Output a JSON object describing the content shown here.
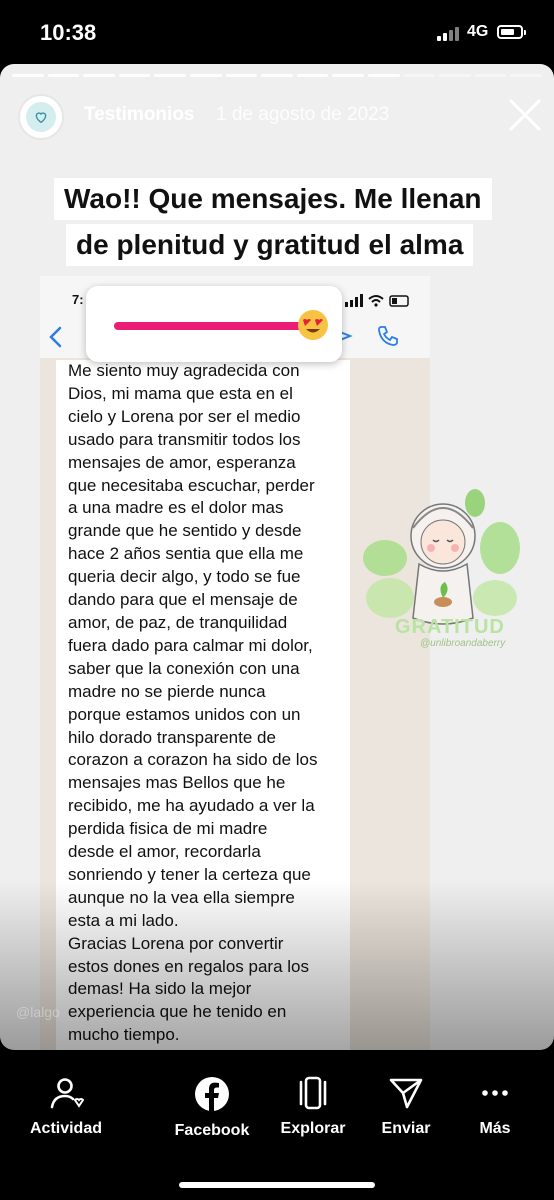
{
  "status_bar": {
    "time": "10:38",
    "network": "4G"
  },
  "story": {
    "account_name": "Testimonios",
    "date": "1 de agosto de 2023",
    "headline_line1": "Wao!! Que mensajes. Me llenan",
    "headline_line2": "de plenitud y gratitud el alma",
    "screenshot": {
      "phone_time": "7:",
      "message": "Me siento muy agradecida con\nDios, mi mama que esta en el\ncielo y Lorena por ser el medio\nusado para transmitir todos los\nmensajes de amor, esperanza\nque necesitaba escuchar, perder\na una madre es el dolor mas\ngrande que he sentido y desde\nhace 2 años sentia que ella me\nqueria decir algo, y todo se fue\ndando para que el mensaje de\namor, de paz, de tranquilidad\nfuera dado para calmar mi dolor,\nsaber que la conexión con una\nmadre no se pierde nunca\nporque estamos unidos con un\nhilo dorado transparente de\ncorazon a corazon ha sido de los\nmensajes mas Bellos que he\nrecibido, me ha ayudado a ver la\nperdida fisica de mi madre\ndesde el amor, recordarla\nsonriendo y tener la certeza que\naunque no la vea ella siempre\nesta a mi lado.\nGracias Lorena por convertir\nestos dones en regalos para los\ndemas! Ha sido la mejor\nexperiencia que he tenido en\nmucho tiempo."
    },
    "slider": {
      "emoji": "heart-eyes-emoji",
      "value": 1.0,
      "color": "#ec1d74"
    },
    "sticker": {
      "text": "GRATITUD",
      "subtext": "@unlibroandaberry"
    },
    "watermark": "@lalgo"
  },
  "bottom_nav": [
    {
      "label": "Actividad",
      "icon": "activity-icon"
    },
    {
      "label": "Facebook",
      "icon": "facebook-icon"
    },
    {
      "label": "Explorar",
      "icon": "explore-icon"
    },
    {
      "label": "Enviar",
      "icon": "send-icon"
    },
    {
      "label": "Más",
      "icon": "more-icon"
    }
  ]
}
